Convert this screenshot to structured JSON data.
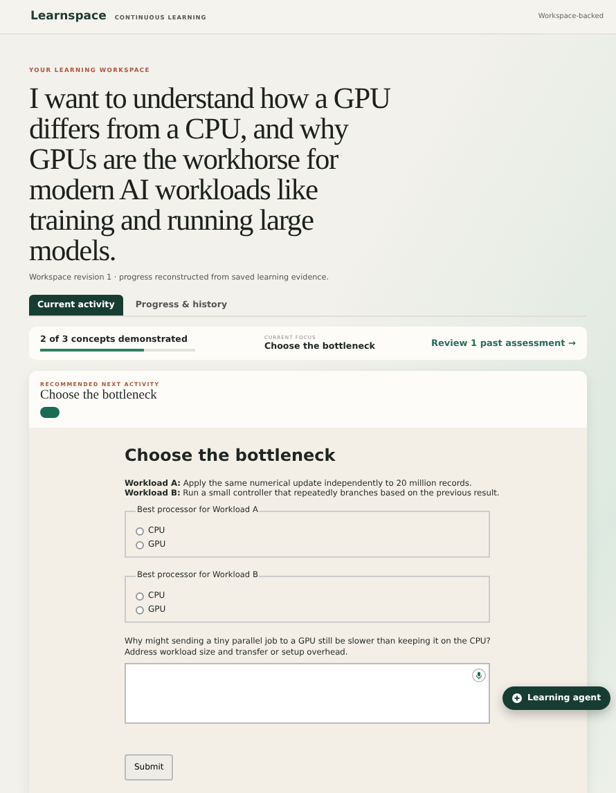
{
  "header": {
    "brand": "Learnspace",
    "tagline": "CONTINUOUS LEARNING",
    "status": "Workspace-backed"
  },
  "hero": {
    "eyebrow": "YOUR LEARNING WORKSPACE",
    "title": "I want to understand how a GPU differs from a CPU, and why GPUs are the workhorse for modern AI workloads like training and running large models.",
    "subtitle": "Workspace revision 1 · progress reconstructed from saved learning evidence."
  },
  "tabs": [
    {
      "label": "Current activity",
      "selected": true
    },
    {
      "label": "Progress & history",
      "selected": false
    }
  ],
  "summary": {
    "concepts": "2 of 3 concepts demonstrated",
    "level": 0.67,
    "focus_label": "CURRENT FOCUS",
    "focus": "Choose the bottleneck",
    "review_link": "Review 1 past assessment →"
  },
  "activity": {
    "eyebrow": "RECOMMENDED NEXT ACTIVITY",
    "title": "Choose the bottleneck",
    "heading": "Choose the bottleneck",
    "workloads": [
      "**Workload A:** Apply the same numerical update independently to 20 million records.",
      "**Workload B:** Run a small controller that repeatedly branches based on the previous result."
    ],
    "groups": [
      {
        "legend": "Best processor for Workload A",
        "options": [
          {
            "label": "CPU",
            "selected": false
          },
          {
            "label": "GPU",
            "selected": false
          }
        ]
      },
      {
        "legend": "Best processor for Workload B",
        "options": [
          {
            "label": "CPU",
            "selected": false
          },
          {
            "label": "GPU",
            "selected": false
          }
        ]
      }
    ],
    "question": "Why might sending a tiny parallel job to a GPU still be slower than keeping it on the CPU? Address workload size and transfer or setup overhead.",
    "submit": "Submit"
  },
  "agent_button": "Learning agent"
}
